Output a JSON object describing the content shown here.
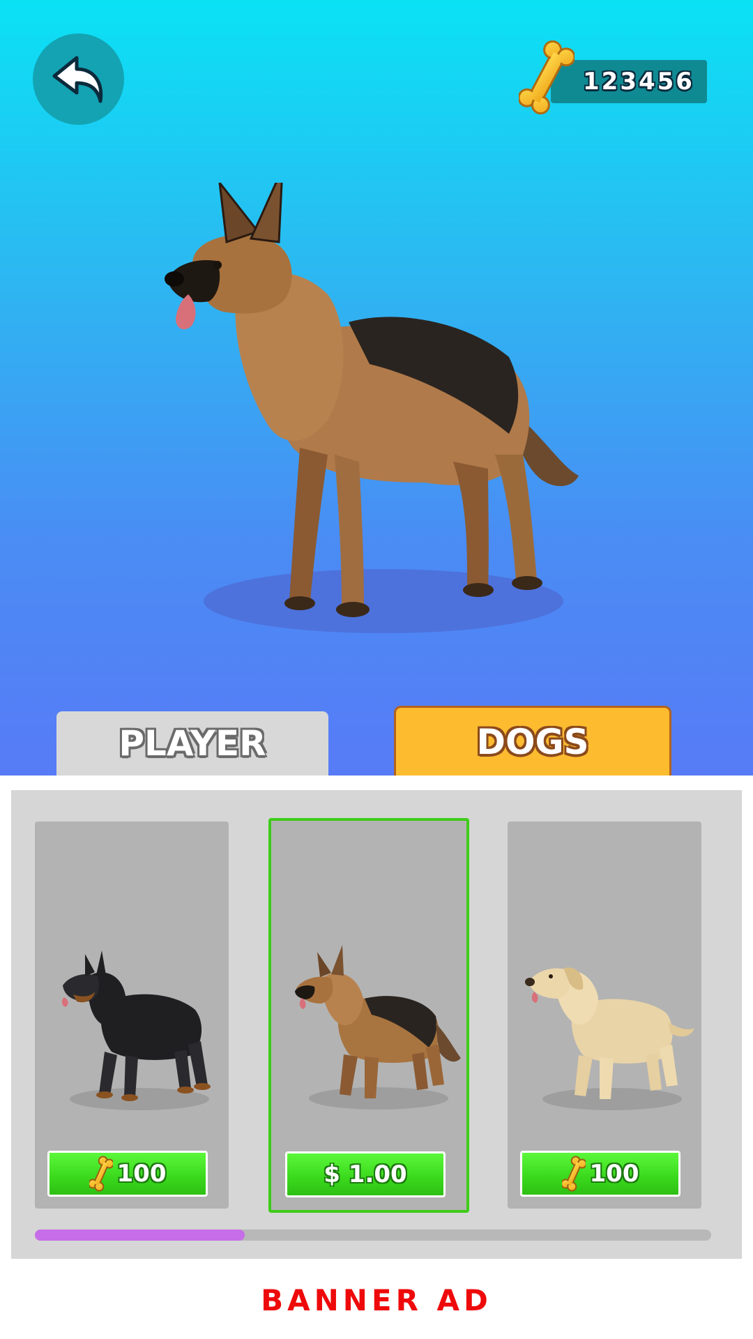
{
  "header": {
    "back_icon": "undo-arrow-icon",
    "currency_icon": "bone-icon",
    "currency_value": "123456"
  },
  "showcase": {
    "selected_dog": "german-shepherd"
  },
  "tabs": [
    {
      "label": "PLAYER",
      "active": false
    },
    {
      "label": "DOGS",
      "active": true
    }
  ],
  "shop": {
    "items": [
      {
        "breed": "doberman",
        "price_icon": "bone-icon",
        "price_label": "100",
        "selected": false
      },
      {
        "breed": "german-shepherd",
        "price_icon": "",
        "price_label": "$ 1.00",
        "selected": true
      },
      {
        "breed": "labrador",
        "price_icon": "bone-icon",
        "price_label": "100",
        "selected": false
      }
    ],
    "scroll_progress": 0.31
  },
  "banner": {
    "label": "BANNER AD"
  },
  "colors": {
    "selected_border": "#3ecc1a",
    "tab_active": "#fdbb30",
    "buy_button": "#3ad81c",
    "progress": "#c66de8",
    "banner_text": "#ee0a0a"
  }
}
